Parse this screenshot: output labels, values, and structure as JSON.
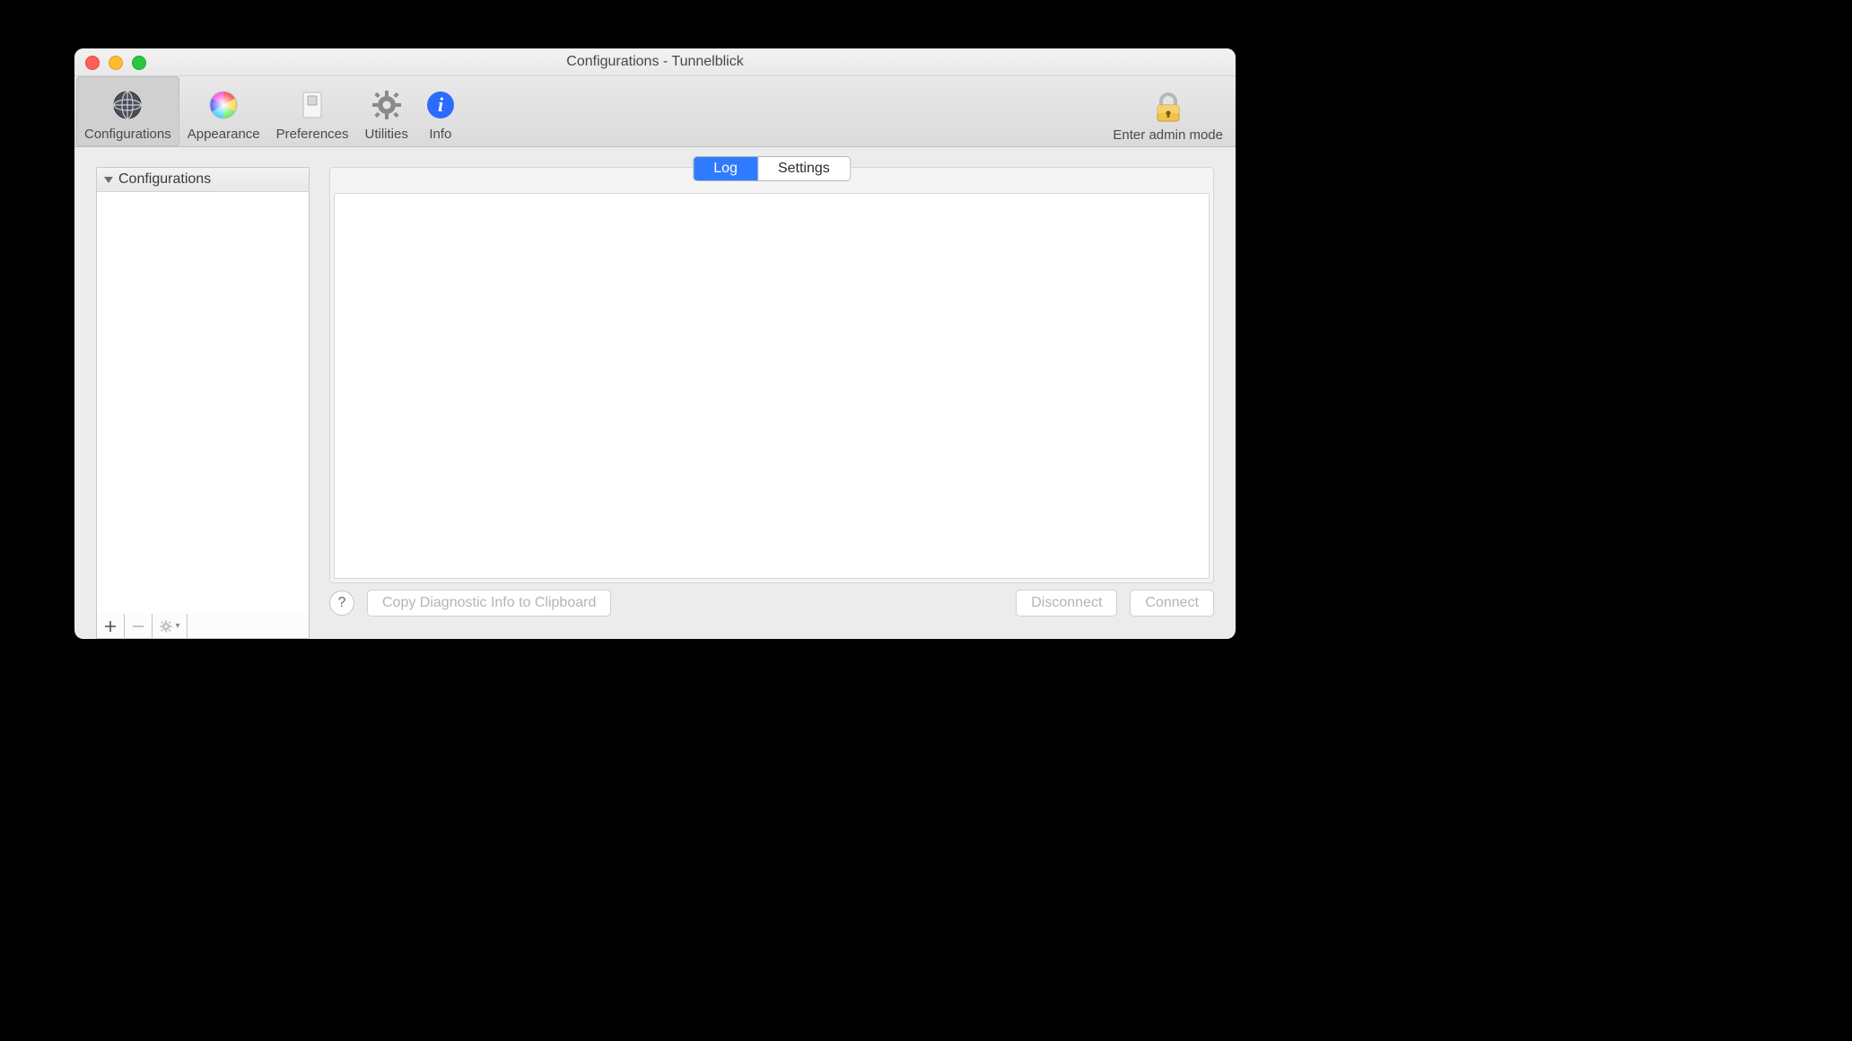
{
  "window": {
    "title": "Configurations - Tunnelblick"
  },
  "toolbar": {
    "items": [
      {
        "label": "Configurations",
        "selected": true
      },
      {
        "label": "Appearance",
        "selected": false
      },
      {
        "label": "Preferences",
        "selected": false
      },
      {
        "label": "Utilities",
        "selected": false
      },
      {
        "label": "Info",
        "selected": false
      }
    ],
    "admin_label": "Enter admin mode"
  },
  "sidebar": {
    "header": "Configurations",
    "items": [],
    "add_tooltip": "Add configuration",
    "remove_tooltip": "Remove configuration",
    "action_tooltip": "Actions"
  },
  "main": {
    "tabs": [
      {
        "label": "Log",
        "selected": true
      },
      {
        "label": "Settings",
        "selected": false
      }
    ],
    "log_text": ""
  },
  "footer": {
    "help_label": "?",
    "copy_label": "Copy Diagnostic Info to Clipboard",
    "disconnect_label": "Disconnect",
    "connect_label": "Connect"
  }
}
